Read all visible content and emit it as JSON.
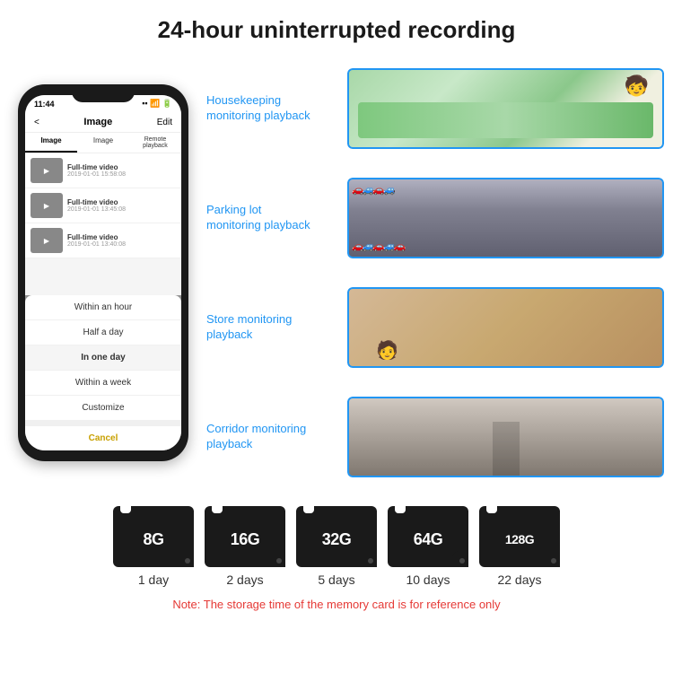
{
  "header": {
    "title": "24-hour uninterrupted recording"
  },
  "phone": {
    "time": "11:44",
    "nav_title": "Image",
    "nav_back": "<",
    "nav_edit": "Edit",
    "tabs": [
      "Image",
      "Image",
      "Remote playback"
    ],
    "list_items": [
      {
        "title": "Full-time video",
        "sub": "2019-01-01 15:58:08"
      },
      {
        "title": "Full-time video",
        "sub": "2019-01-01 13:45:08"
      },
      {
        "title": "Full-time video",
        "sub": "2019-01-01 13:40:08"
      }
    ],
    "dropdown_items": [
      "Within an hour",
      "Half a day",
      "In one day",
      "Within a week",
      "Customize"
    ],
    "cancel_label": "Cancel"
  },
  "monitoring": [
    {
      "label": "Housekeeping monitoring playback",
      "img_class": "img-housekeeping"
    },
    {
      "label": "Parking lot monitoring playback",
      "img_class": "img-parking"
    },
    {
      "label": "Store monitoring playback",
      "img_class": "img-store"
    },
    {
      "label": "Corridor monitoring playback",
      "img_class": "img-corridor"
    }
  ],
  "storage_cards": [
    {
      "size": "8G",
      "days": "1 day"
    },
    {
      "size": "16G",
      "days": "2 days"
    },
    {
      "size": "32G",
      "days": "5 days"
    },
    {
      "size": "64G",
      "days": "10 days"
    },
    {
      "size": "128G",
      "days": "22 days"
    }
  ],
  "storage_note": "Note: The storage time of the memory card is for reference only"
}
